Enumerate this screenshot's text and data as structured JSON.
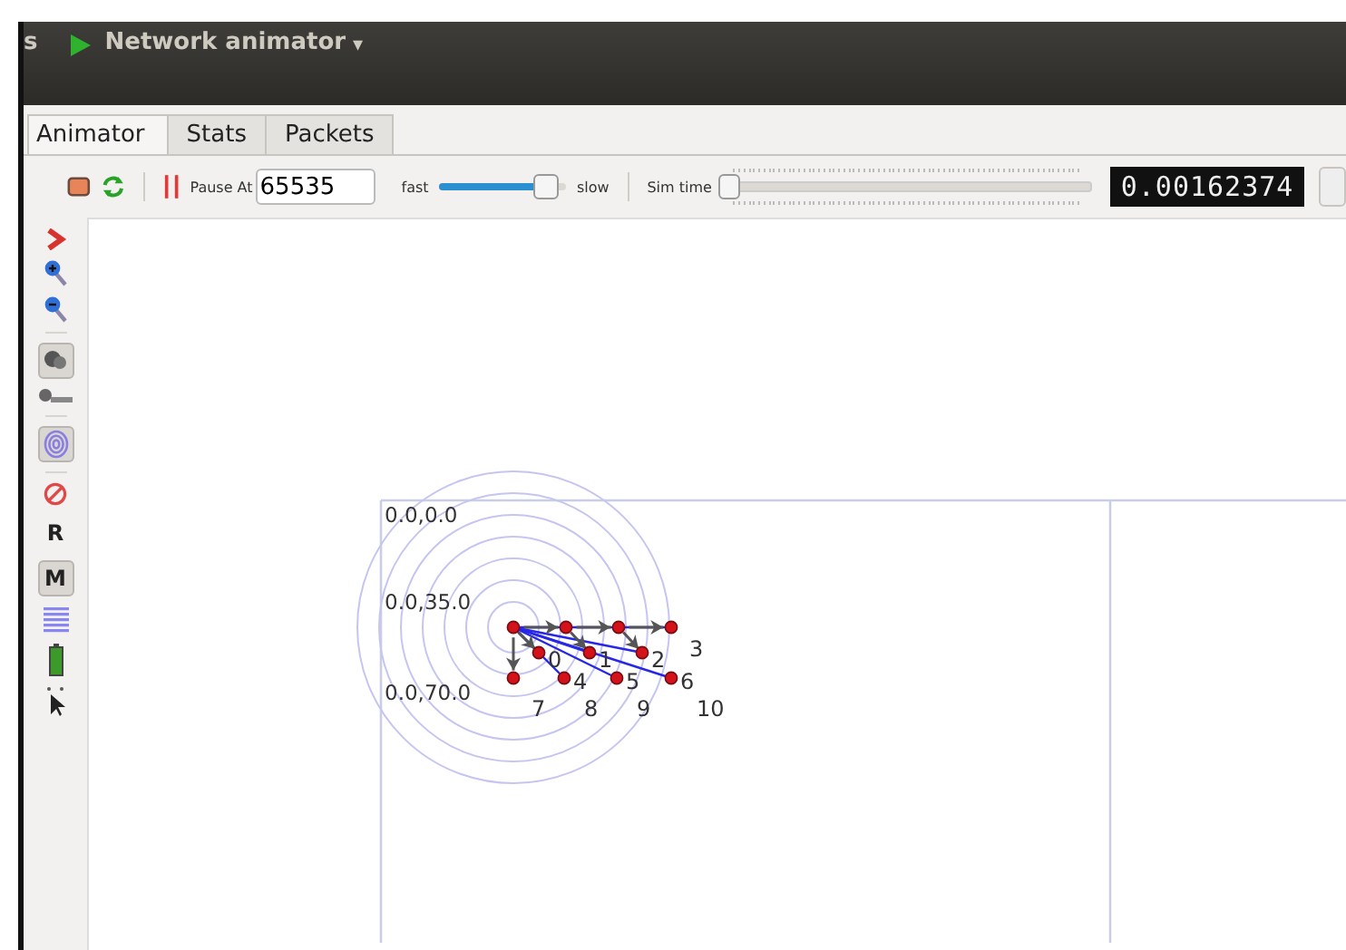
{
  "title_bar": {
    "app_fragment": "s",
    "title": "Network animator",
    "menu_caret": "▾"
  },
  "tabs": [
    {
      "label": "Animator",
      "selected": true
    },
    {
      "label": "Stats",
      "selected": false
    },
    {
      "label": "Packets",
      "selected": false
    }
  ],
  "toolbar": {
    "pause_label": "Pause At",
    "pause_at": "65535",
    "fast_label": "fast",
    "speed": {
      "level": 0.85
    },
    "slow_label": "slow",
    "sim_time_label": "Sim time",
    "sim_time": {
      "level": 0
    },
    "sim_time_display": "0.00162374"
  },
  "side_tools": [
    {
      "kind": "chevron"
    },
    {
      "kind": "zoomin"
    },
    {
      "kind": "zoomout"
    },
    {
      "kind": "nodeid",
      "selected": true
    },
    {
      "kind": "ipmac"
    },
    {
      "kind": "range",
      "selected": true
    },
    {
      "kind": "block"
    },
    {
      "kind": "text",
      "label": "R",
      "selected": false
    },
    {
      "kind": "text",
      "label": "M",
      "selected": true
    },
    {
      "kind": "lines"
    },
    {
      "kind": "battery"
    },
    {
      "kind": "pointer"
    }
  ],
  "canvas": {
    "grid_labels": [
      "0.0,0.0",
      "0.0,35.0",
      "0.0,70.0"
    ],
    "nodes": [
      {
        "label": "0"
      },
      {
        "label": "1"
      },
      {
        "label": "2"
      },
      {
        "label": "3"
      },
      {
        "label": "4"
      },
      {
        "label": "5"
      },
      {
        "label": "6"
      },
      {
        "label": "7"
      },
      {
        "label": "8"
      },
      {
        "label": "9"
      },
      {
        "label": "10"
      }
    ]
  }
}
